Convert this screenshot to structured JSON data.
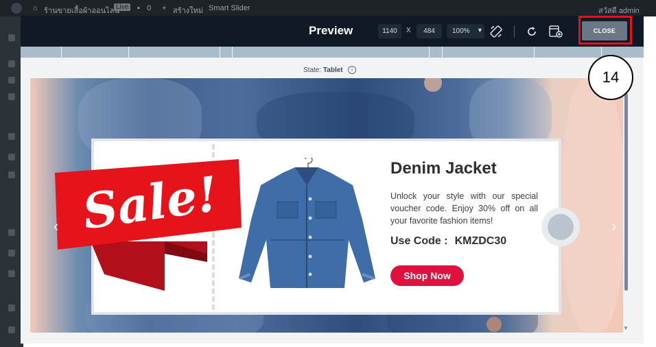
{
  "wp_admin_bar": {
    "site_name": "ร้านขายเสื้อผ้าออนไลน์",
    "live_badge": "Live",
    "comments_count": "0",
    "new_label": "สร้างใหม่",
    "plugin_label": "Smart Slider",
    "user_label": "สวัสดี admin"
  },
  "modal": {
    "title": "Preview",
    "width_value": "1140",
    "x_label": "X",
    "height_value": "484",
    "zoom_value": "100%",
    "close_label": "CLOSE",
    "state_prefix": "State: ",
    "state_value": "Tablet"
  },
  "slide": {
    "sale_text": "Sale!",
    "title": "Denim Jacket",
    "description": "Unlock your style with our special voucher code. Enjoy 30% off on all your favorite fashion items!",
    "code_label": "Use Code :",
    "code_value": "KMZDC30",
    "button_label": "Shop Now",
    "prev_arrow": "‹",
    "next_arrow": "›"
  },
  "annotation": {
    "step_number": "14",
    "highlight_color": "#e8101b"
  },
  "colors": {
    "header_bg": "#0f1a26",
    "close_bg": "#6b7785",
    "shop_button": "#e0113f",
    "sale_red": "#e5141b"
  }
}
